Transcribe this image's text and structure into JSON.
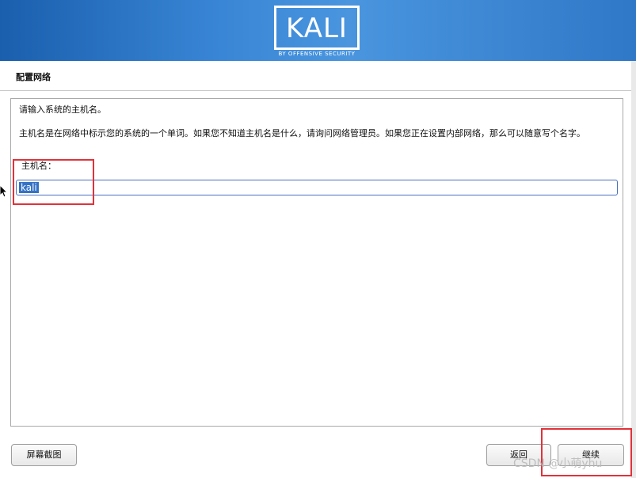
{
  "banner": {
    "logo_text": "KALI",
    "logo_subtitle": "BY OFFENSIVE SECURITY",
    "brand_color": "#2f78c8"
  },
  "section": {
    "title": "配置网络"
  },
  "content": {
    "prompt": "请输入系统的主机名。",
    "description": "主机名是在网络中标示您的系统的一个单词。如果您不知道主机名是什么，请询问网络管理员。如果您正在设置内部网络，那么可以随意写个名字。",
    "hostname_label": "主机名：",
    "hostname_value": "kali"
  },
  "buttons": {
    "screenshot": "屏幕截图",
    "back": "返回",
    "continue": "继续"
  },
  "annotation": {
    "highlight_color": "#e0323a"
  },
  "watermark": {
    "text": "CSDN @小萌yhu"
  }
}
